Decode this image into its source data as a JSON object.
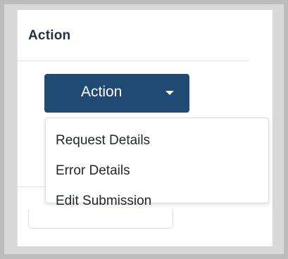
{
  "panel": {
    "header": "Action"
  },
  "action_button": {
    "label": "Action",
    "icon": "caret-down-icon",
    "color": "#1f4a74"
  },
  "dropdown": {
    "items": [
      {
        "label": "Request Details"
      },
      {
        "label": "Error Details"
      },
      {
        "label": "Edit Submission"
      }
    ]
  }
}
